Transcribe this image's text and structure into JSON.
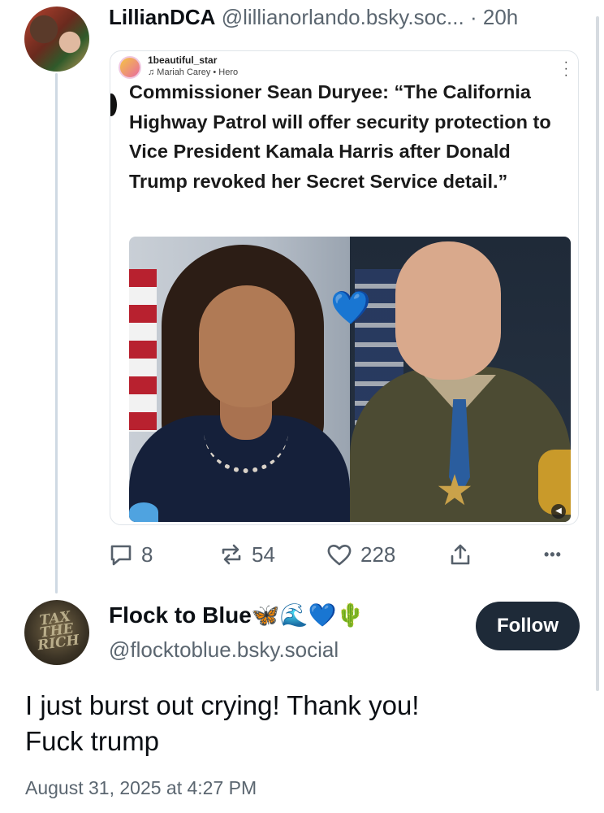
{
  "post": {
    "display_name": "LillianDCA",
    "handle": "@lillianorlando.bsky.soc...",
    "separator": "·",
    "time_ago": "20h",
    "avatar_icon": "user-avatar"
  },
  "embed": {
    "author": "1beautiful_star",
    "music": "♫ Mariah Carey • Hero",
    "menu_icon": "kebab-menu-icon",
    "headline": "Commissioner Sean Duryee: “The California Highway Patrol will offer security protection to Vice President Kamala Harris after Donald Trump revoked her Secret Service detail.”",
    "image_icon": "photo-collage",
    "heart": "💙",
    "audio_icon": "speaker-icon"
  },
  "actions": {
    "replies": "8",
    "reposts": "54",
    "likes": "228",
    "reply_icon": "comment-icon",
    "repost_icon": "repost-icon",
    "like_icon": "heart-icon",
    "share_icon": "share-icon",
    "more_icon": "more-dots-icon",
    "more_label": "•••"
  },
  "reply": {
    "display_name": "Flock to Blue",
    "name_emojis": "🦋🌊💙🌵",
    "handle": "@flocktoblue.bsky.social",
    "follow_label": "Follow",
    "avatar_text": "TAX THE RICH",
    "text_line1": "I just burst out crying!  Thank you!",
    "text_line2": "Fuck trump",
    "timestamp": "August 31, 2025 at 4:27 PM"
  },
  "colors": {
    "text": "#0b0f14",
    "muted": "#5b6670",
    "follow_bg": "#1e2a38",
    "thread_line": "#cfd9e3"
  }
}
